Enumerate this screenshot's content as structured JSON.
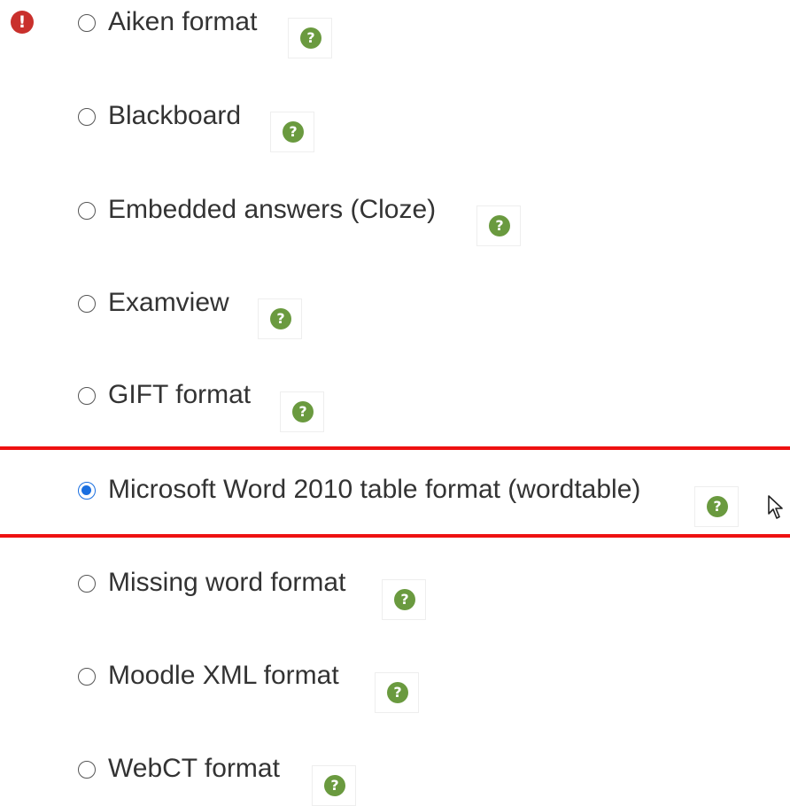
{
  "error_indicator": {
    "glyph": "!",
    "color": "#c9302c"
  },
  "options": [
    {
      "label": "Aiken format",
      "checked": false,
      "help_icon": "question-circle-icon"
    },
    {
      "label": "Blackboard",
      "checked": false,
      "help_icon": "question-circle-icon"
    },
    {
      "label": "Embedded answers (Cloze)",
      "checked": false,
      "help_icon": "question-circle-icon"
    },
    {
      "label": "Examview",
      "checked": false,
      "help_icon": "question-circle-icon"
    },
    {
      "label": "GIFT format",
      "checked": false,
      "help_icon": "question-circle-icon"
    },
    {
      "label": "Microsoft Word 2010 table format (wordtable)",
      "checked": true,
      "help_icon": "question-circle-icon"
    },
    {
      "label": "Missing word format",
      "checked": false,
      "help_icon": "question-circle-icon"
    },
    {
      "label": "Moodle XML format",
      "checked": false,
      "help_icon": "question-circle-icon"
    },
    {
      "label": "WebCT format",
      "checked": false,
      "help_icon": "question-circle-icon"
    }
  ],
  "help_glyph": "?",
  "colors": {
    "highlight": "#ee1111",
    "radio_checked": "#1a6fe0",
    "help_icon": "#6a9a3f",
    "text": "#333333"
  }
}
